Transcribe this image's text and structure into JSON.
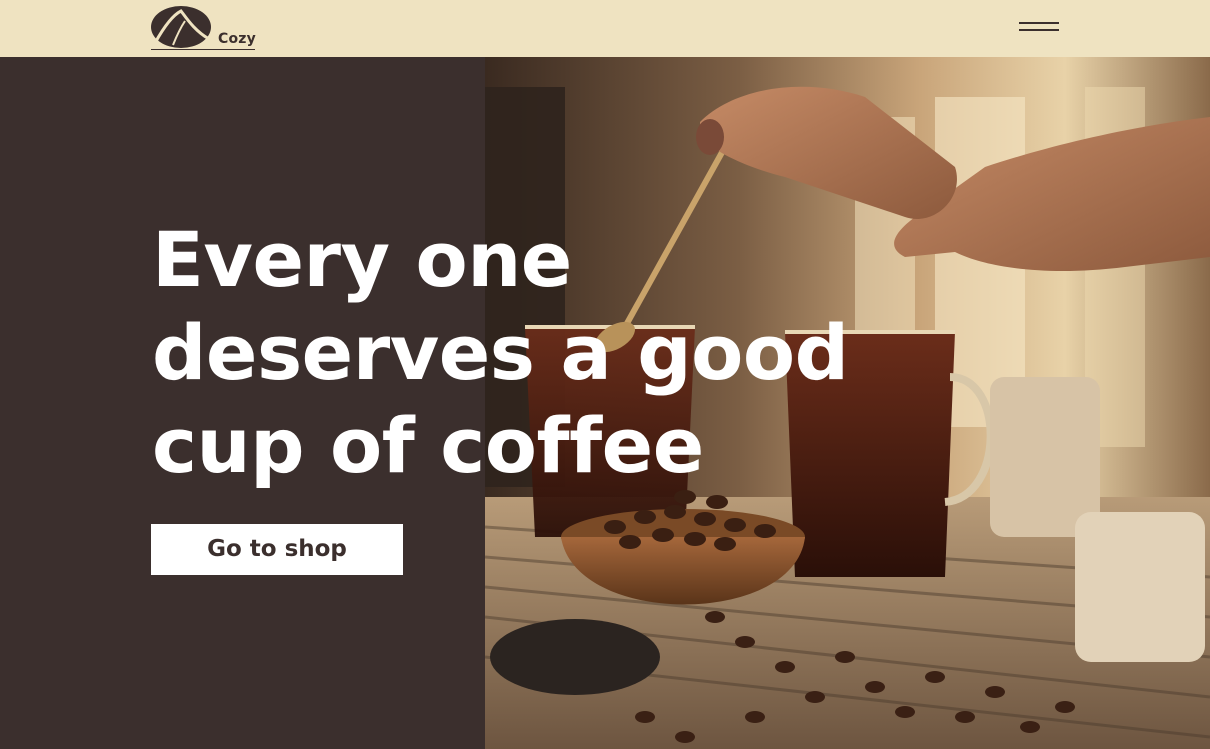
{
  "brand": {
    "name": "Cozy",
    "logo_icon": "coffee-bean-logo-icon"
  },
  "header": {
    "menu_icon": "hamburger-menu-icon"
  },
  "hero": {
    "headline_lines": [
      "Every one",
      "deserves a good",
      "cup of coffee"
    ],
    "cta_label": "Go to shop",
    "photo_subject": "coffee-photo"
  },
  "colors": {
    "header_bg": "#efe3c1",
    "dark_brown": "#3b2f2d",
    "cta_bg": "#ffffff",
    "headline_text": "#ffffff"
  }
}
